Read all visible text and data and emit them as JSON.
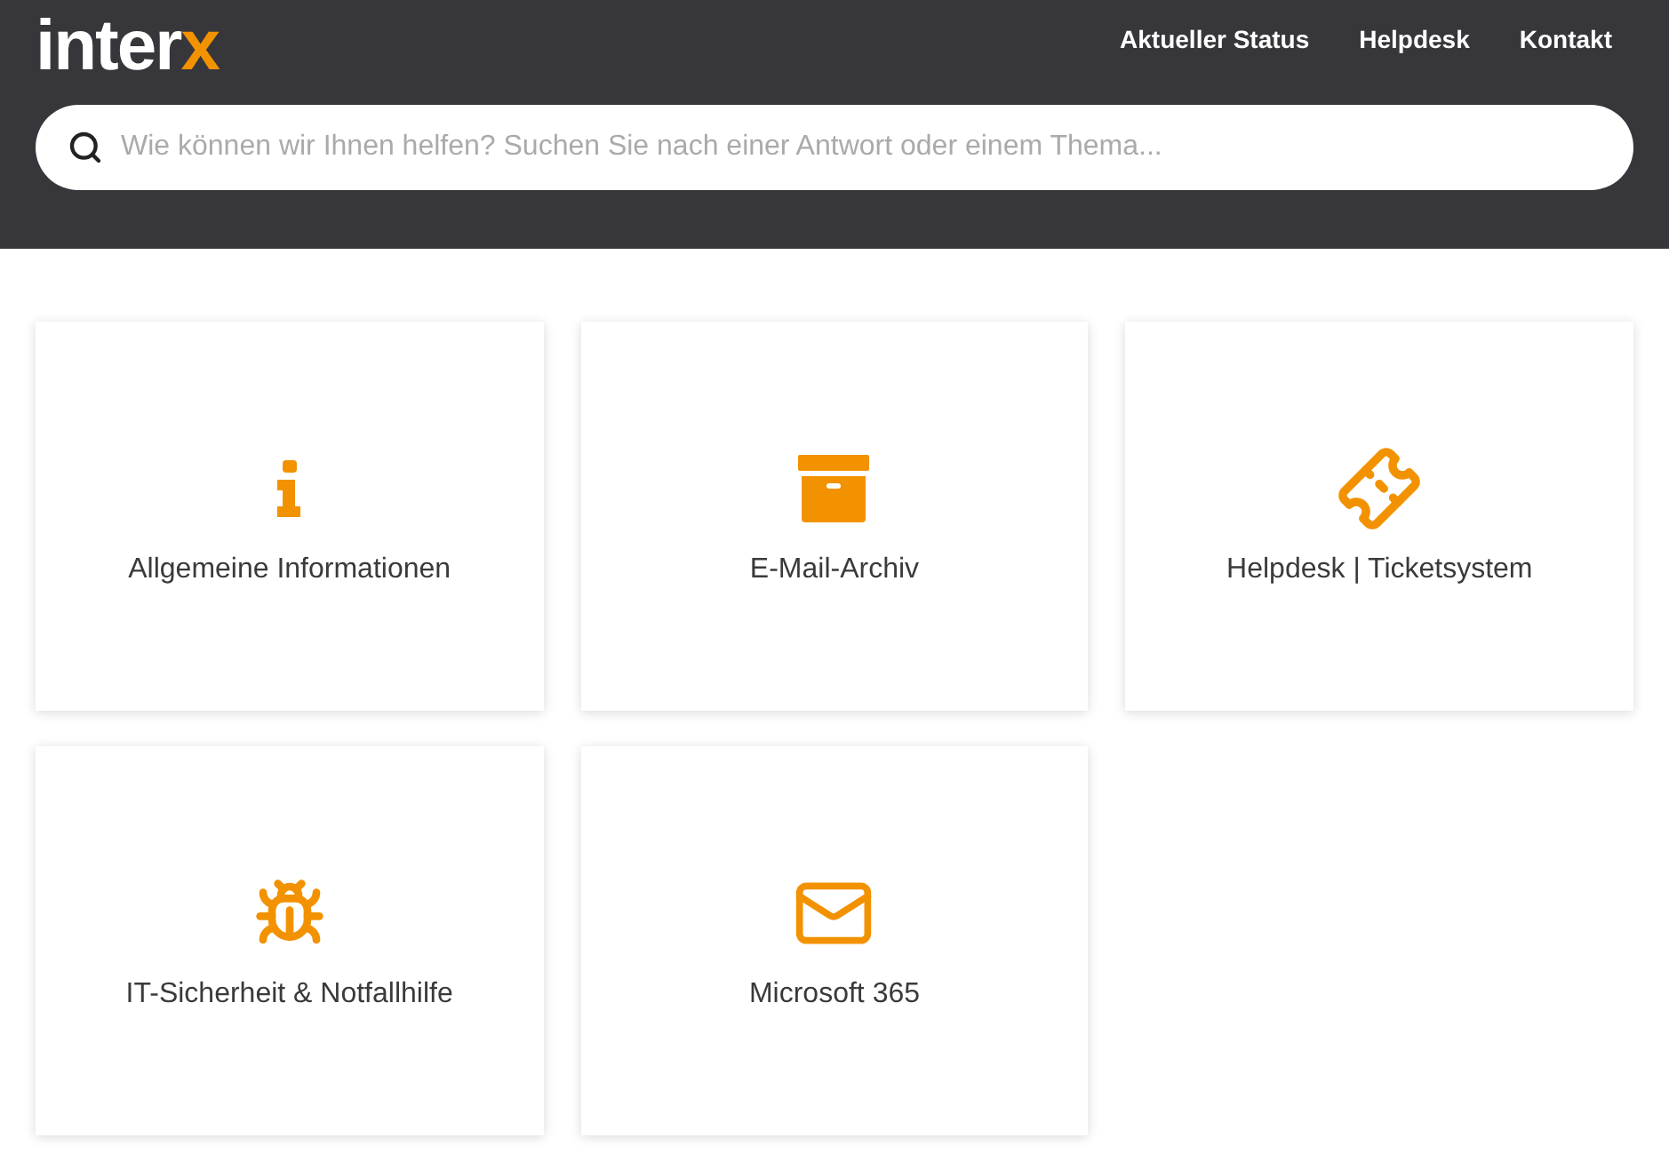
{
  "header": {
    "logo": {
      "main": "inter",
      "accent": "x"
    },
    "nav": [
      "Aktueller Status",
      "Helpdesk",
      "Kontakt"
    ],
    "search": {
      "placeholder": "Wie können wir Ihnen helfen? Suchen Sie nach einer Antwort oder einem Thema..."
    }
  },
  "cards": [
    {
      "label": "Allgemeine Informationen"
    },
    {
      "label": "E-Mail-Archiv"
    },
    {
      "label": "Helpdesk | Ticketsystem"
    },
    {
      "label": "IT-Sicherheit & Notfallhilfe"
    },
    {
      "label": "Microsoft 365"
    }
  ]
}
